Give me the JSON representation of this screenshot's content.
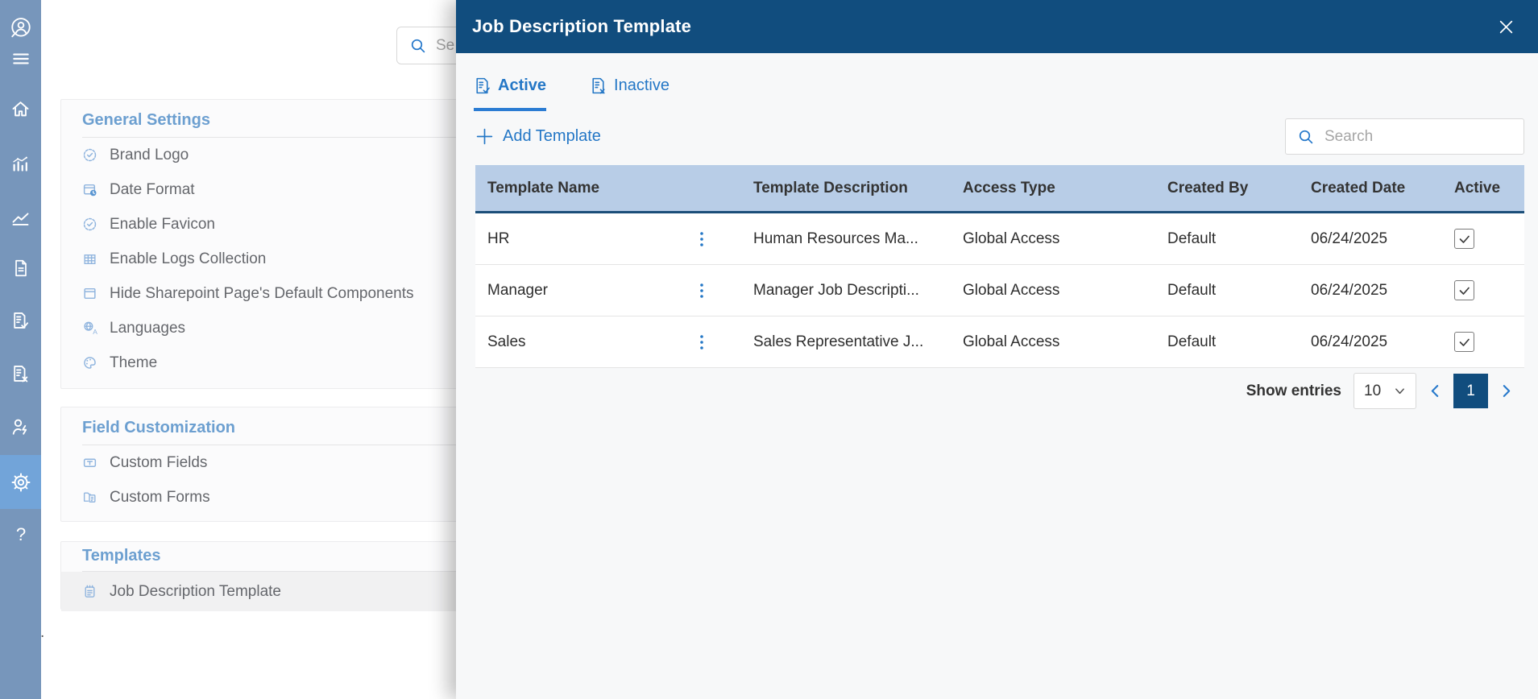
{
  "colors": {
    "accent_blue": "#2477c6",
    "header_navy": "#114d7e",
    "table_header_bg": "#b8cde7",
    "sidebar_bg": "#7796bb",
    "sidebar_active_bg": "#72a4d9",
    "section_heading": "#6c9fd0"
  },
  "sidebar": {
    "items": [
      {
        "icon": "profile-avatar-icon"
      },
      {
        "icon": "menu-icon"
      },
      {
        "icon": "home-icon"
      },
      {
        "icon": "bar-chart-icon"
      },
      {
        "icon": "line-chart-icon"
      },
      {
        "icon": "document-icon"
      },
      {
        "icon": "document-check-icon"
      },
      {
        "icon": "document-x-icon"
      },
      {
        "icon": "user-bolt-icon"
      },
      {
        "icon": "gear-icon",
        "active": true
      },
      {
        "icon": "help-icon"
      }
    ]
  },
  "glyphs": {
    "question": "?"
  },
  "page": {
    "search": {
      "placeholder": "Se"
    },
    "stray_dot": ".",
    "sections": [
      {
        "title": "General Settings",
        "items": [
          {
            "label": "Brand Logo",
            "icon": "badge-check-icon"
          },
          {
            "label": "Date Format",
            "icon": "calendar-clock-icon"
          },
          {
            "label": "Enable Favicon",
            "icon": "badge-check-icon"
          },
          {
            "label": "Enable Logs Collection",
            "icon": "logs-grid-icon"
          },
          {
            "label": "Hide Sharepoint Page's Default Components",
            "icon": "window-icon"
          },
          {
            "label": "Languages",
            "icon": "translate-icon"
          },
          {
            "label": "Theme",
            "icon": "palette-icon"
          }
        ]
      },
      {
        "title": "Field Customization",
        "items": [
          {
            "label": "Custom Fields",
            "icon": "text-field-icon"
          },
          {
            "label": "Custom Forms",
            "icon": "folder-form-icon"
          }
        ]
      },
      {
        "title": "Templates",
        "items": [
          {
            "label": "Job Description Template",
            "icon": "notepad-icon",
            "selected": true
          }
        ]
      }
    ]
  },
  "modal": {
    "title": "Job Description Template",
    "tabs": [
      {
        "label": "Active",
        "icon": "document-check-icon",
        "active": true
      },
      {
        "label": "Inactive",
        "icon": "document-x-icon",
        "active": false
      }
    ],
    "add_button": {
      "label": "Add Template",
      "icon": "plus-icon"
    },
    "search": {
      "placeholder": "Search",
      "icon": "search-icon"
    },
    "table": {
      "columns": [
        "Template Name",
        "Template Description",
        "Access Type",
        "Created By",
        "Created Date",
        "Active"
      ],
      "rows": [
        {
          "name": "HR",
          "description": "Human Resources Ma...",
          "access_type": "Global Access",
          "created_by": "Default",
          "created_date": "06/24/2025",
          "active": true
        },
        {
          "name": "Manager",
          "description": "Manager Job Descripti...",
          "access_type": "Global Access",
          "created_by": "Default",
          "created_date": "06/24/2025",
          "active": true
        },
        {
          "name": "Sales",
          "description": "Sales Representative J...",
          "access_type": "Global Access",
          "created_by": "Default",
          "created_date": "06/24/2025",
          "active": true
        }
      ]
    },
    "pagination": {
      "show_entries_label": "Show entries",
      "page_size": "10",
      "current_page": "1"
    }
  }
}
